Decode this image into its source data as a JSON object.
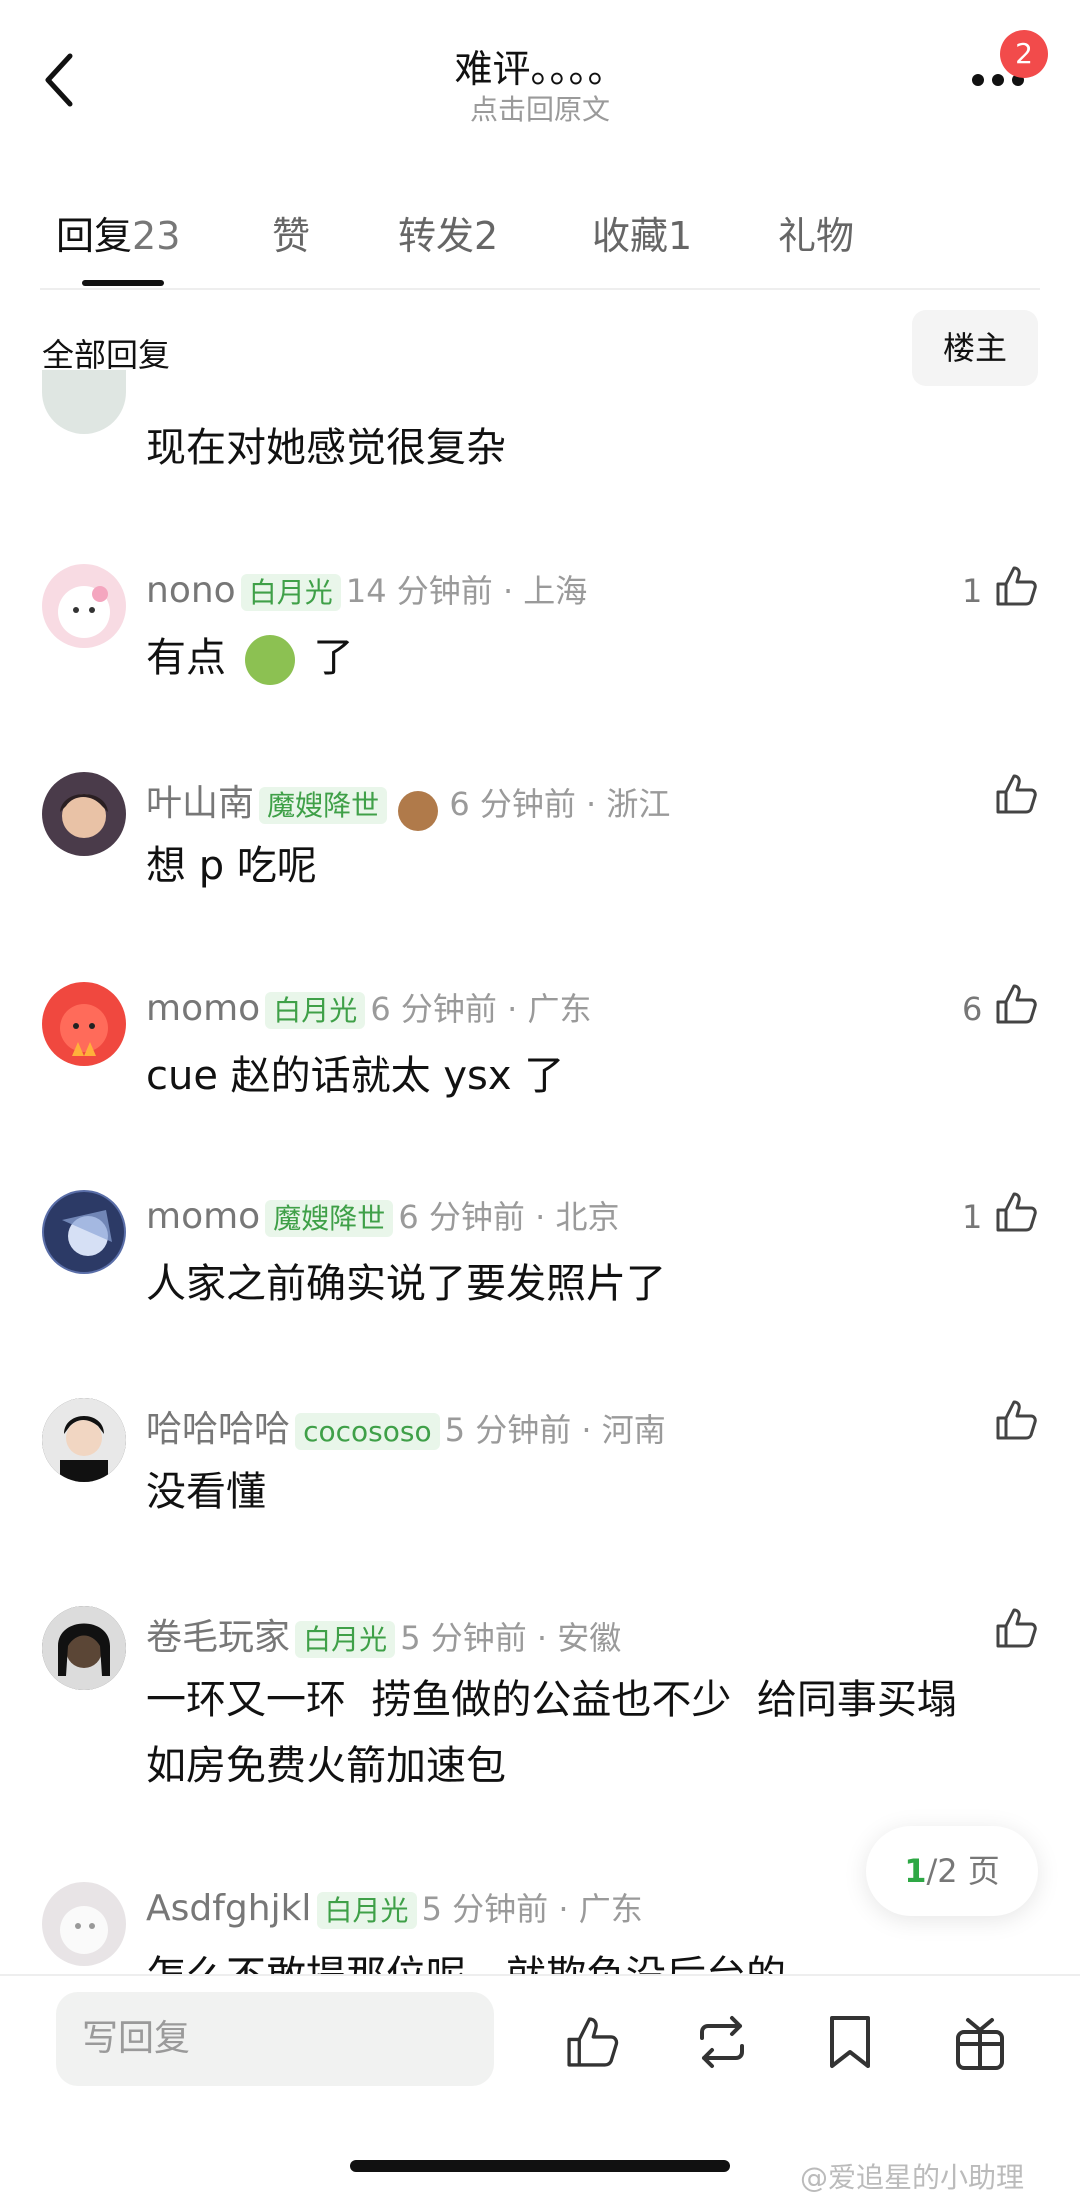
{
  "header": {
    "title": "难评。。。。",
    "subtitle": "点击回原文",
    "badge_count": "2",
    "back_icon": "back-chevron-icon",
    "more_icon": "more-dots-icon"
  },
  "tabs": [
    {
      "label": "回复",
      "count": "23"
    },
    {
      "label": "赞",
      "count": ""
    },
    {
      "label": "转发",
      "count": "2"
    },
    {
      "label": "收藏",
      "count": "1"
    },
    {
      "label": "礼物",
      "count": ""
    }
  ],
  "section": {
    "title": "全部回复",
    "owner_button": "楼主"
  },
  "partial_comment": {
    "text": "现在对她感觉很复杂"
  },
  "comments": [
    {
      "user": "nono",
      "tag": "白月光",
      "meta": "14 分钟前 · 上海",
      "likes": "1",
      "text": "有点",
      "text_suffix": "了",
      "avatar_color": "#f8dbe3"
    },
    {
      "user": "叶山南",
      "tag": "魔嫂降世",
      "meta": "6 分钟前 · 浙江",
      "likes": "",
      "text": "想 p 吃呢",
      "avatar_color": "#4a3b4a"
    },
    {
      "user": "momo",
      "tag": "白月光",
      "meta": "6 分钟前 · 广东",
      "likes": "6",
      "text": "cue 赵的话就太 ysx 了",
      "avatar_color": "#f0483f"
    },
    {
      "user": "momo",
      "tag": "魔嫂降世",
      "meta": "6 分钟前 · 北京",
      "likes": "1",
      "text": "人家之前确实说了要发照片了",
      "avatar_color": "#5a6ea8"
    },
    {
      "user": "哈哈哈哈",
      "tag": "cocososo",
      "meta": "5 分钟前 · 河南",
      "likes": "",
      "text": "没看懂",
      "avatar_color": "#2b2b2b"
    },
    {
      "user": "卷毛玩家",
      "tag": "白月光",
      "meta": "5 分钟前 · 安徽",
      "likes": "",
      "text_line1": "一环又一环  捞鱼做的公益也不少  给同事买塌",
      "text_line2": "如房免费火箭加速包",
      "avatar_color": "#3a3a3a"
    },
    {
      "user": "Asdfghjkl",
      "tag": "白月光",
      "meta": "5 分钟前 · 广东",
      "likes": "",
      "text": "怎么不敢提那位呢，就欺负没后台的",
      "avatar_color": "#e8e4e6"
    }
  ],
  "pager": {
    "current": "1",
    "total_text": "/2 页"
  },
  "bottom": {
    "reply_placeholder": "写回复",
    "icons": [
      "like-icon",
      "repost-icon",
      "bookmark-icon",
      "gift-icon"
    ]
  },
  "watermark": "@爱追星的小助理"
}
